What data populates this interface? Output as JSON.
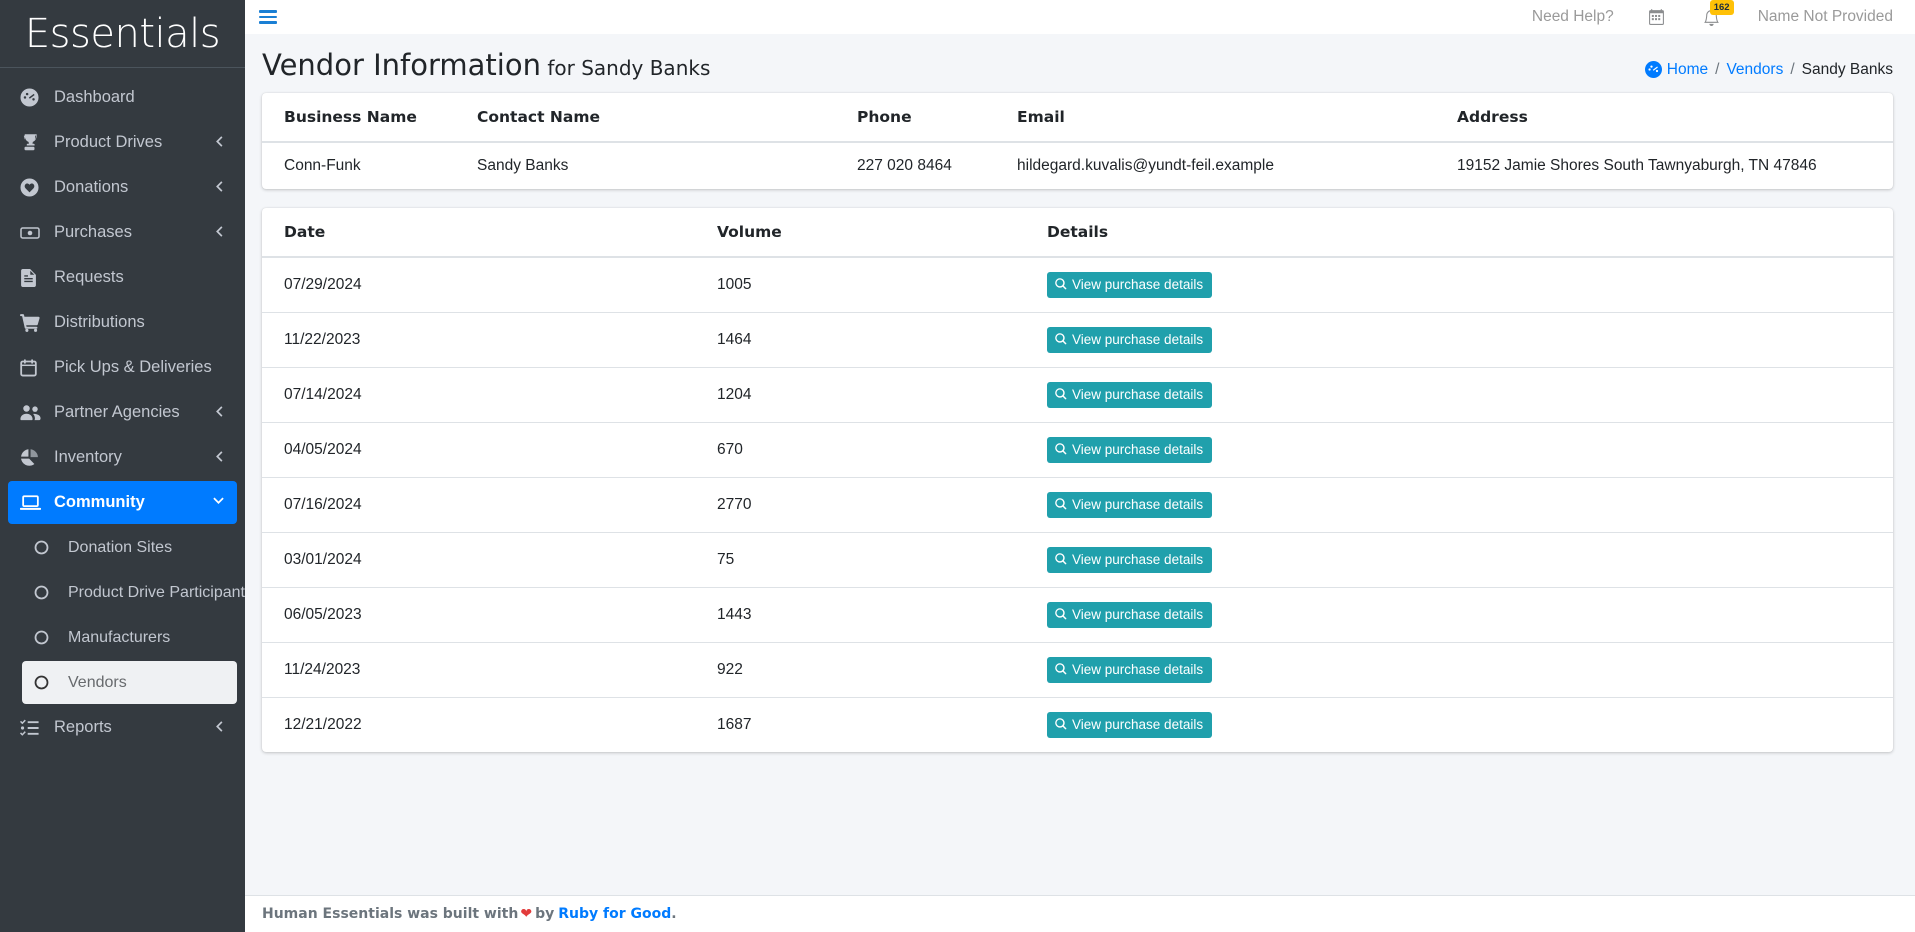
{
  "brand": {
    "name": "Essentials"
  },
  "sidebar": {
    "items": [
      {
        "label": "Dashboard",
        "icon": "dashboard-icon",
        "arrow": "",
        "state": "normal",
        "sub": false
      },
      {
        "label": "Product Drives",
        "icon": "trophy-icon",
        "arrow": "‹",
        "state": "normal",
        "sub": false
      },
      {
        "label": "Donations",
        "icon": "heart-circle-icon",
        "arrow": "‹",
        "state": "normal",
        "sub": false
      },
      {
        "label": "Purchases",
        "icon": "money-bill-icon",
        "arrow": "‹",
        "state": "normal",
        "sub": false
      },
      {
        "label": "Requests",
        "icon": "document-icon",
        "arrow": "",
        "state": "normal",
        "sub": false
      },
      {
        "label": "Distributions",
        "icon": "cart-icon",
        "arrow": "",
        "state": "normal",
        "sub": false
      },
      {
        "label": "Pick Ups & Deliveries",
        "icon": "calendar-icon",
        "arrow": "",
        "state": "normal",
        "sub": false
      },
      {
        "label": "Partner Agencies",
        "icon": "users-icon",
        "arrow": "‹",
        "state": "normal",
        "sub": false
      },
      {
        "label": "Inventory",
        "icon": "pie-chart-icon",
        "arrow": "‹",
        "state": "normal",
        "sub": false
      },
      {
        "label": "Community",
        "icon": "laptop-icon",
        "arrow": "‹",
        "state": "active",
        "sub": false
      },
      {
        "label": "Donation Sites",
        "icon": "circle-icon",
        "arrow": "",
        "state": "normal",
        "sub": true
      },
      {
        "label": "Product Drive Participants",
        "icon": "circle-icon",
        "arrow": "",
        "state": "normal",
        "sub": true
      },
      {
        "label": "Manufacturers",
        "icon": "circle-icon",
        "arrow": "",
        "state": "normal",
        "sub": true
      },
      {
        "label": "Vendors",
        "icon": "circle-icon",
        "arrow": "",
        "state": "hovered",
        "sub": true
      },
      {
        "label": "Reports",
        "icon": "list-check-icon",
        "arrow": "‹",
        "state": "normal",
        "sub": false
      }
    ]
  },
  "topbar": {
    "menu_toggle": "hamburger-icon",
    "need_help": "Need Help?",
    "calendar_icon": "calendar-icon",
    "bell_icon": "bell-icon",
    "notification_count": "162",
    "user_name": "Name Not Provided"
  },
  "header": {
    "title_main": "Vendor Information",
    "title_suffix": " for Sandy Banks",
    "breadcrumb": {
      "home": "Home",
      "vendors": "Vendors",
      "current": "Sandy Banks",
      "separator": "/"
    }
  },
  "vendor_table": {
    "columns": [
      "Business Name",
      "Contact Name",
      "Phone",
      "Email",
      "Address"
    ],
    "row": {
      "business_name": "Conn-Funk",
      "contact_name": "Sandy Banks",
      "phone": "227 020 8464",
      "email": "hildegard.kuvalis@yundt-feil.example",
      "address": "19152 Jamie Shores South Tawnyaburgh, TN 47846"
    }
  },
  "purchases_table": {
    "columns": [
      "Date",
      "Volume",
      "Details"
    ],
    "button_label": "View purchase details",
    "rows": [
      {
        "date": "07/29/2024",
        "volume": "1005"
      },
      {
        "date": "11/22/2023",
        "volume": "1464"
      },
      {
        "date": "07/14/2024",
        "volume": "1204"
      },
      {
        "date": "04/05/2024",
        "volume": "670"
      },
      {
        "date": "07/16/2024",
        "volume": "2770"
      },
      {
        "date": "03/01/2024",
        "volume": "75"
      },
      {
        "date": "06/05/2023",
        "volume": "1443"
      },
      {
        "date": "11/24/2023",
        "volume": "922"
      },
      {
        "date": "12/21/2022",
        "volume": "1687"
      }
    ]
  },
  "footer": {
    "text_before": "Human Essentials was built with",
    "heart": "❤",
    "text_by": "by",
    "link": "Ruby for Good",
    "period": "."
  },
  "colors": {
    "sidebar_bg": "#343a40",
    "accent_blue": "#007bff",
    "button_teal": "#20a0ac",
    "badge_yellow": "#ffc107",
    "page_bg": "#f4f6f9",
    "heart_red": "#e23b3b"
  }
}
